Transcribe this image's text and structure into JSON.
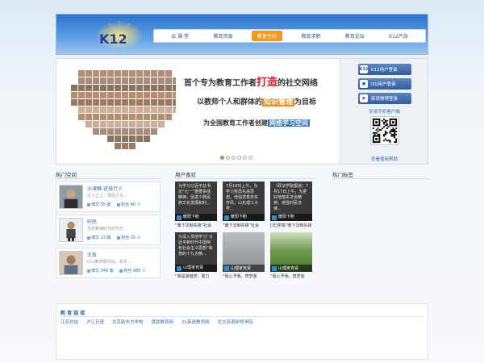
{
  "header": {
    "logo_text": "K12",
    "nav": [
      "云 课 堂",
      "教育资源",
      "教育空间",
      "教育求职",
      "教育论坛",
      "K12产品"
    ],
    "active_index": 2
  },
  "banner": {
    "slogan1_a": "首个专为教育工作者",
    "slogan1_hl": "打造",
    "slogan1_b": "的社交网络",
    "slogan2_a": "以教师个人和群体的",
    "slogan2_hl": "知识管理",
    "slogan2_b": "为目标",
    "slogan3_a": "为全国教育工作者创建",
    "slogan3_hl": "网络学习空间",
    "slide_count": 6,
    "active_slide": 0
  },
  "login": {
    "k12_login": "K12用户登录",
    "qq_login": "QQ用户登录",
    "weibo_login": "新浪微博登录",
    "k12_icon": "K12",
    "app_link": "安卓手机客户端",
    "help_link": "查看使用帮助"
  },
  "sections": {
    "hot_space": "热门空间",
    "user_likes": "用户喜欢",
    "hot_tags": "热门标签"
  },
  "people": [
    {
      "name": "沙漠棘-逆旅行人",
      "desc": "在人之上，视别人为...",
      "posts": "博文 55 篇",
      "fans": "粉丝 80 人"
    },
    {
      "name": "阿民",
      "desc": "当天教读时代的光芒...",
      "posts": "博文 13 篇",
      "fans": "粉丝 15 人"
    },
    {
      "name": "王玫",
      "desc": "K12教育网论坛，多年...",
      "posts": "博文 348 篇",
      "fans": "粉丝 985 人"
    }
  ],
  "likes": [
    {
      "text": "为学习习近平总书记“七一”重要讲话精神，促进少数民族文化发展和利...",
      "author": "暖阳下盼",
      "caption": "“暖下法制先锋”社会",
      "style": "dark"
    },
    {
      "text": "7月18日上午，为学习党员先进思想，增强求真务实作风，山东理工大学...",
      "author": "暖阳下盼",
      "caption": "“暖下法制先锋”社会",
      "style": "dark"
    },
    {
      "text": "（政法学院报道）7月17日上午，为更好地落实法治精神，增强村民法律...",
      "author": "暖阳下盼",
      "caption": "[法]学院“暖下法制先锋",
      "style": "dark"
    },
    {
      "text": "为深入贯彻学习“习近平新时代中国特色社会主义思想”和党的十九大精...",
      "author": "山理家克贤",
      "caption": "“我是渐趋梦，赋力",
      "style": "dark"
    },
    {
      "text": "",
      "author": "山理家克贤",
      "caption": "“砥心予我，筑梦金",
      "style": "gray"
    },
    {
      "text": "",
      "author": "山理家克贤",
      "caption": "“砥心予我，筑梦金",
      "style": "green"
    }
  ],
  "friend_links": {
    "title": "教 育 链 接",
    "items": [
      "江苏总结",
      "沪江日语",
      "北京新东方学校",
      "慧助教育网",
      "21英语教师网",
      "北大资源研修学院"
    ]
  },
  "colors": {
    "header_blue": "#2a74cf",
    "nav_active": "#f39a1e",
    "link_blue": "#2d6cb8",
    "highlight_red": "#d7191c"
  }
}
